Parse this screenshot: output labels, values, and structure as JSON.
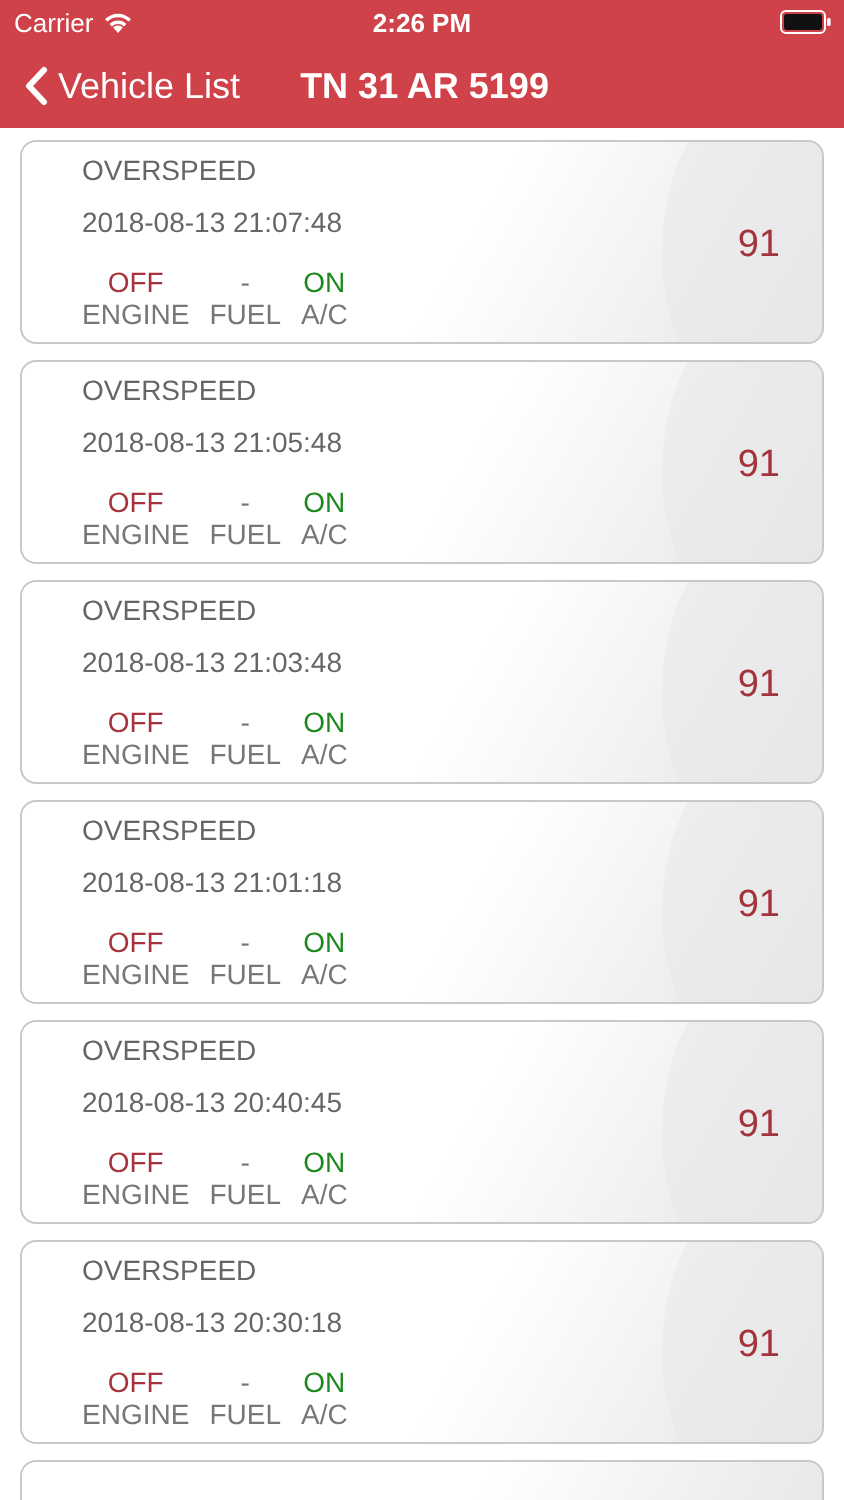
{
  "status_bar": {
    "carrier": "Carrier",
    "time": "2:26 PM"
  },
  "nav": {
    "back_label": "Vehicle List",
    "title": "TN 31 AR 5199"
  },
  "events": [
    {
      "type": "OVERSPEED",
      "time": "2018-08-13 21:07:48",
      "speed": "91",
      "stats": [
        {
          "value": "OFF",
          "label": "ENGINE",
          "color": "#a8323c"
        },
        {
          "value": "-",
          "label": "FUEL",
          "color": "#777777"
        },
        {
          "value": "ON",
          "label": "A/C",
          "color": "#1e8a1e"
        }
      ]
    },
    {
      "type": "OVERSPEED",
      "time": "2018-08-13 21:05:48",
      "speed": "91",
      "stats": [
        {
          "value": "OFF",
          "label": "ENGINE",
          "color": "#a8323c"
        },
        {
          "value": "-",
          "label": "FUEL",
          "color": "#777777"
        },
        {
          "value": "ON",
          "label": "A/C",
          "color": "#1e8a1e"
        }
      ]
    },
    {
      "type": "OVERSPEED",
      "time": "2018-08-13 21:03:48",
      "speed": "91",
      "stats": [
        {
          "value": "OFF",
          "label": "ENGINE",
          "color": "#a8323c"
        },
        {
          "value": "-",
          "label": "FUEL",
          "color": "#777777"
        },
        {
          "value": "ON",
          "label": "A/C",
          "color": "#1e8a1e"
        }
      ]
    },
    {
      "type": "OVERSPEED",
      "time": "2018-08-13 21:01:18",
      "speed": "91",
      "stats": [
        {
          "value": "OFF",
          "label": "ENGINE",
          "color": "#a8323c"
        },
        {
          "value": "-",
          "label": "FUEL",
          "color": "#777777"
        },
        {
          "value": "ON",
          "label": "A/C",
          "color": "#1e8a1e"
        }
      ]
    },
    {
      "type": "OVERSPEED",
      "time": "2018-08-13 20:40:45",
      "speed": "91",
      "stats": [
        {
          "value": "OFF",
          "label": "ENGINE",
          "color": "#a8323c"
        },
        {
          "value": "-",
          "label": "FUEL",
          "color": "#777777"
        },
        {
          "value": "ON",
          "label": "A/C",
          "color": "#1e8a1e"
        }
      ]
    },
    {
      "type": "OVERSPEED",
      "time": "2018-08-13 20:30:18",
      "speed": "91",
      "stats": [
        {
          "value": "OFF",
          "label": "ENGINE",
          "color": "#a8323c"
        },
        {
          "value": "-",
          "label": "FUEL",
          "color": "#777777"
        },
        {
          "value": "ON",
          "label": "A/C",
          "color": "#1e8a1e"
        }
      ]
    }
  ]
}
